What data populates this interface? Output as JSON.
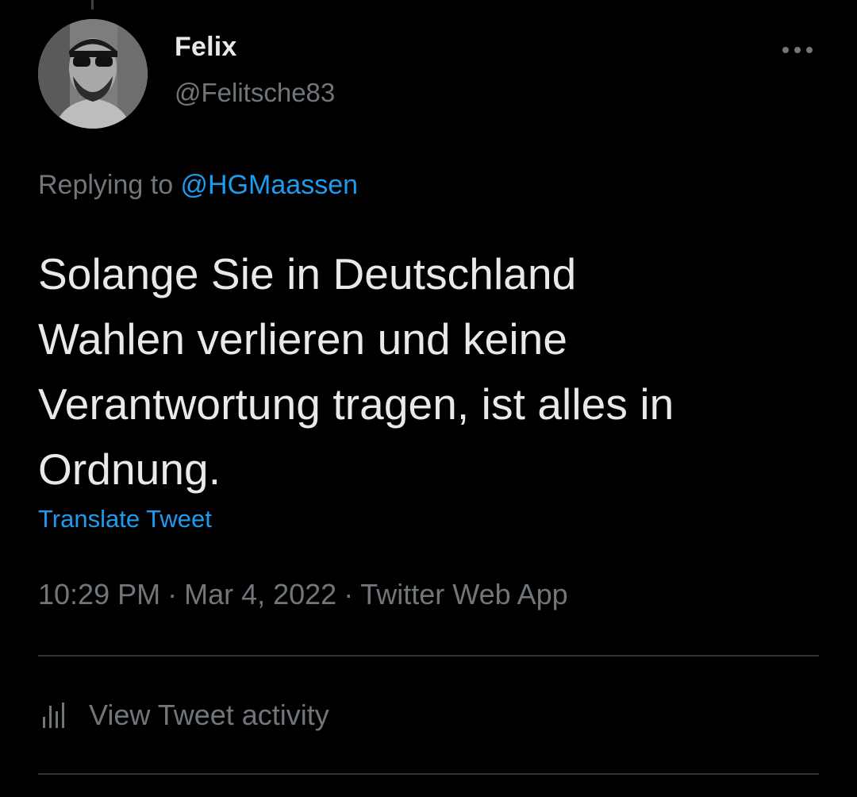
{
  "author": {
    "name": "Felix",
    "handle": "@Felitsche83"
  },
  "reply": {
    "prefix": "Replying to ",
    "mention": "@HGMaassen"
  },
  "tweet": {
    "lines": [
      "Solange Sie in Deutschland",
      "Wahlen verlieren und keine",
      "Verantwortung tragen, ist alles in",
      "Ordnung."
    ],
    "translate_label": "Translate Tweet"
  },
  "meta": {
    "time": "10:29 PM",
    "separator": "·",
    "date": "Mar 4, 2022",
    "source": "Twitter Web App"
  },
  "activity": {
    "label": "View Tweet activity",
    "icon": "bar-chart-icon"
  },
  "menu": {
    "icon": "more-options-icon"
  },
  "colors": {
    "background": "#000000",
    "primary_text": "#e7e9ea",
    "secondary_text": "#71767b",
    "accent": "#1d9bf0",
    "divider": "#2f3336"
  }
}
